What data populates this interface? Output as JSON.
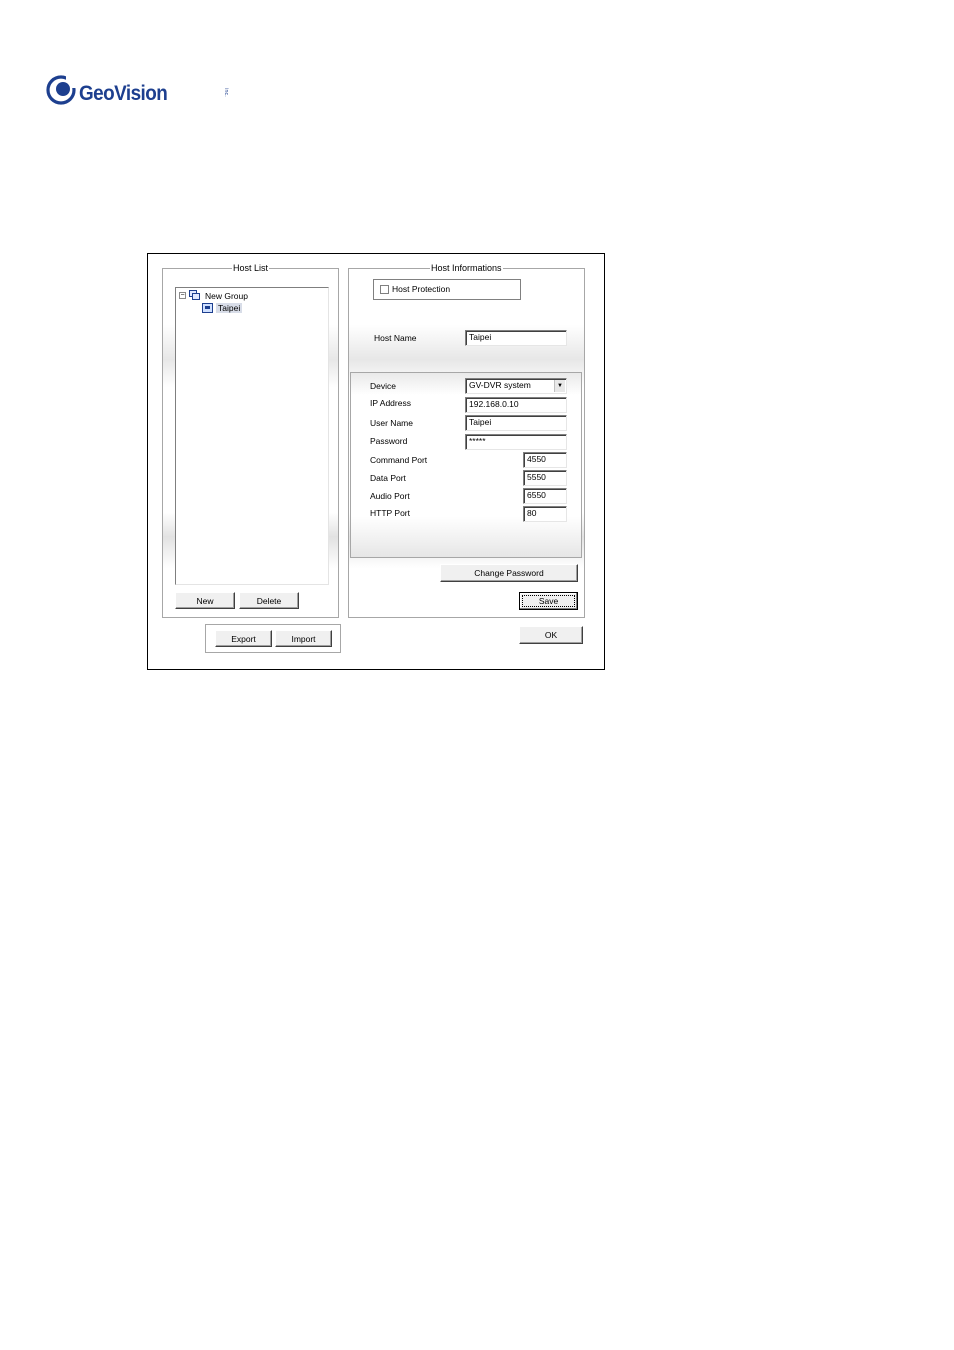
{
  "brand": {
    "name": "GeoVision",
    "tm": "inc."
  },
  "host_list": {
    "legend": "Host List",
    "tree": [
      {
        "label": "New Group",
        "expander": "⊟"
      },
      {
        "label": "Taipei"
      }
    ],
    "new_button": "New",
    "delete_button": "Delete",
    "export_button": "Export",
    "import_button": "Import"
  },
  "host_info": {
    "legend": "Host Informations",
    "host_protection_label": "Host Protection",
    "host_protection_checked": false,
    "host_name_label": "Host Name",
    "host_name_value": "Taipei",
    "device_label": "Device",
    "device_value": "GV-DVR system",
    "ip_label": "IP Address",
    "ip_value": "192.168.0.10",
    "user_label": "User Name",
    "user_value": "Taipei",
    "password_label": "Password",
    "password_value": "*****",
    "command_port_label": "Command Port",
    "command_port_value": "4550",
    "data_port_label": "Data Port",
    "data_port_value": "5550",
    "audio_port_label": "Audio Port",
    "audio_port_value": "6550",
    "http_port_label": "HTTP Port",
    "http_port_value": "80",
    "change_password_button": "Change Password",
    "save_button": "Save"
  },
  "ok_button": "OK",
  "colors": {
    "brand_blue": "#1d3f8f"
  }
}
